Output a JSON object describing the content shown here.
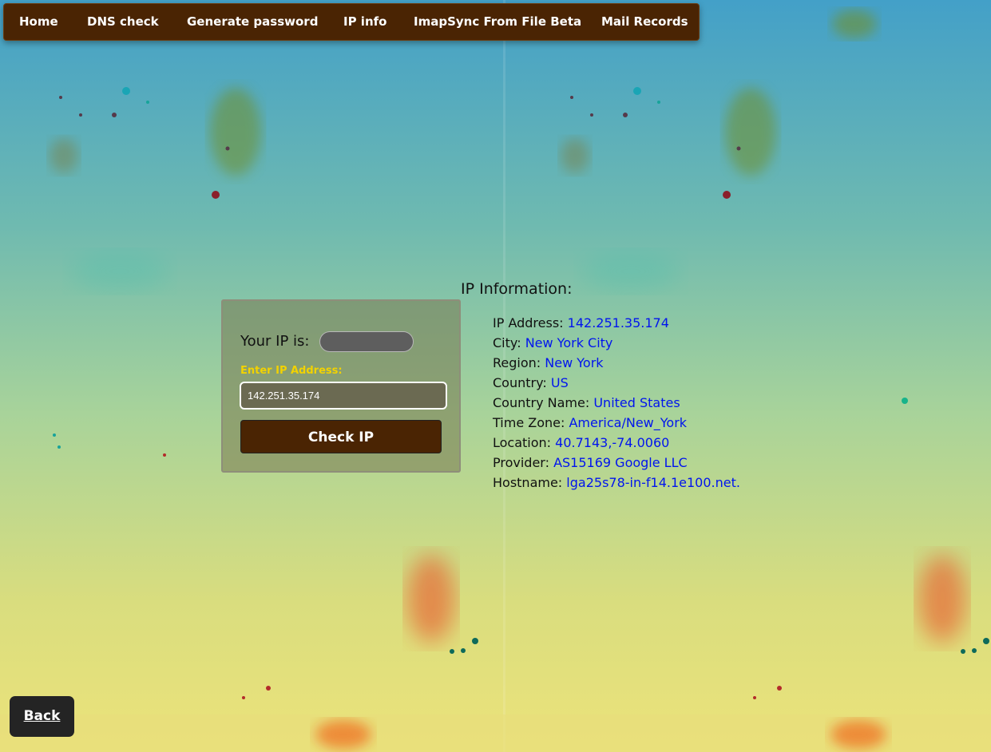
{
  "nav": {
    "items": [
      {
        "label": "Home"
      },
      {
        "label": "DNS check"
      },
      {
        "label": "Generate password"
      },
      {
        "label": "IP info"
      },
      {
        "label": "ImapSync From File Beta"
      },
      {
        "label": "Mail Records"
      }
    ]
  },
  "form": {
    "your_ip_label": "Your IP is:",
    "input_label": "Enter IP Address:",
    "input_value": "142.251.35.174",
    "button_label": "Check IP"
  },
  "info": {
    "title": "IP Information:",
    "rows": [
      {
        "label": "IP Address:",
        "value": "142.251.35.174"
      },
      {
        "label": "City:",
        "value": "New York City"
      },
      {
        "label": "Region:",
        "value": "New York"
      },
      {
        "label": "Country:",
        "value": "US"
      },
      {
        "label": "Country Name:",
        "value": "United States"
      },
      {
        "label": "Time Zone:",
        "value": "America/New_York"
      },
      {
        "label": "Location:",
        "value": "40.7143,-74.0060"
      },
      {
        "label": "Provider:",
        "value": "AS15169 Google LLC"
      },
      {
        "label": "Hostname:",
        "value": "lga25s78-in-f14.1e100.net."
      }
    ]
  },
  "back": {
    "label": "Back"
  },
  "colors": {
    "nav_bg": "#4a2403",
    "input_label": "#f2d200",
    "value_text": "#0014ee",
    "back_bg": "#242424"
  }
}
